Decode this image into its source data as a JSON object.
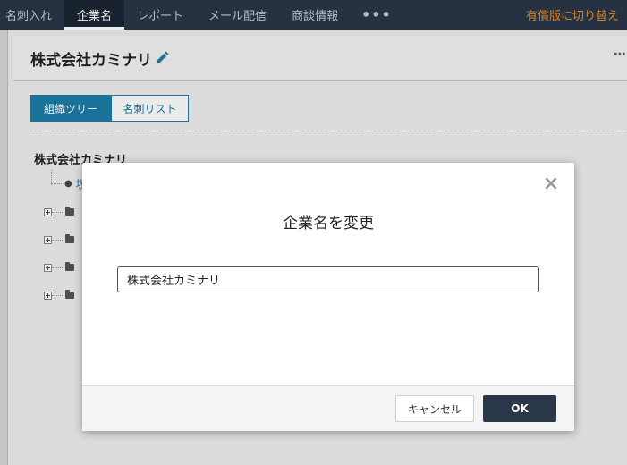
{
  "nav": {
    "items": [
      "名刺入れ",
      "企業名",
      "レポート",
      "メール配信",
      "商談情報"
    ],
    "active_index": 1,
    "more_label": "•••",
    "upgrade_label": "有償版に切り替え"
  },
  "header": {
    "company_name": "株式会社カミナリ",
    "more_label": "⋯"
  },
  "tabs": {
    "org_tree": "組織ツリー",
    "card_list": "名刺リスト"
  },
  "tree": {
    "root": "株式会社カミナリ",
    "person_prefix": "坂"
  },
  "modal": {
    "title": "企業名を変更",
    "input_value": "株式会社カミナリ",
    "cancel_label": "キャンセル",
    "ok_label": "OK",
    "close_symbol": "×"
  },
  "colors": {
    "nav_bg": "#2a3748",
    "accent": "#1d7ca6",
    "upgrade": "#e8912e"
  }
}
